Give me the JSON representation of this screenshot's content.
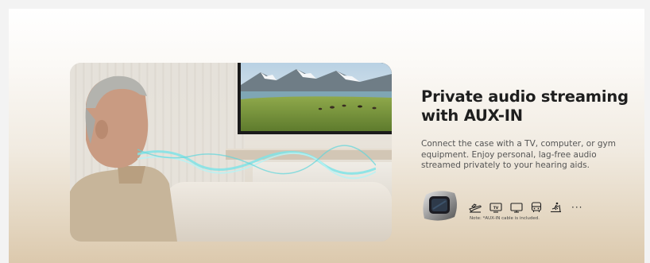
{
  "section": {
    "title": "Private audio streaming with AUX-IN",
    "description": "Connect the case with a TV, computer, or gym equipment. Enjoy personal, lag-free audio streamed privately to your hearing aids.",
    "note": "Note: *AUX-IN cable is included.",
    "more_label": "···"
  },
  "icons": [
    {
      "name": "airplane-icon"
    },
    {
      "name": "tv-icon"
    },
    {
      "name": "monitor-icon"
    },
    {
      "name": "bus-icon"
    },
    {
      "name": "treadmill-icon"
    }
  ],
  "colors": {
    "title": "#1e1e1e",
    "text": "#555555",
    "wave": "#7fe3e6"
  }
}
